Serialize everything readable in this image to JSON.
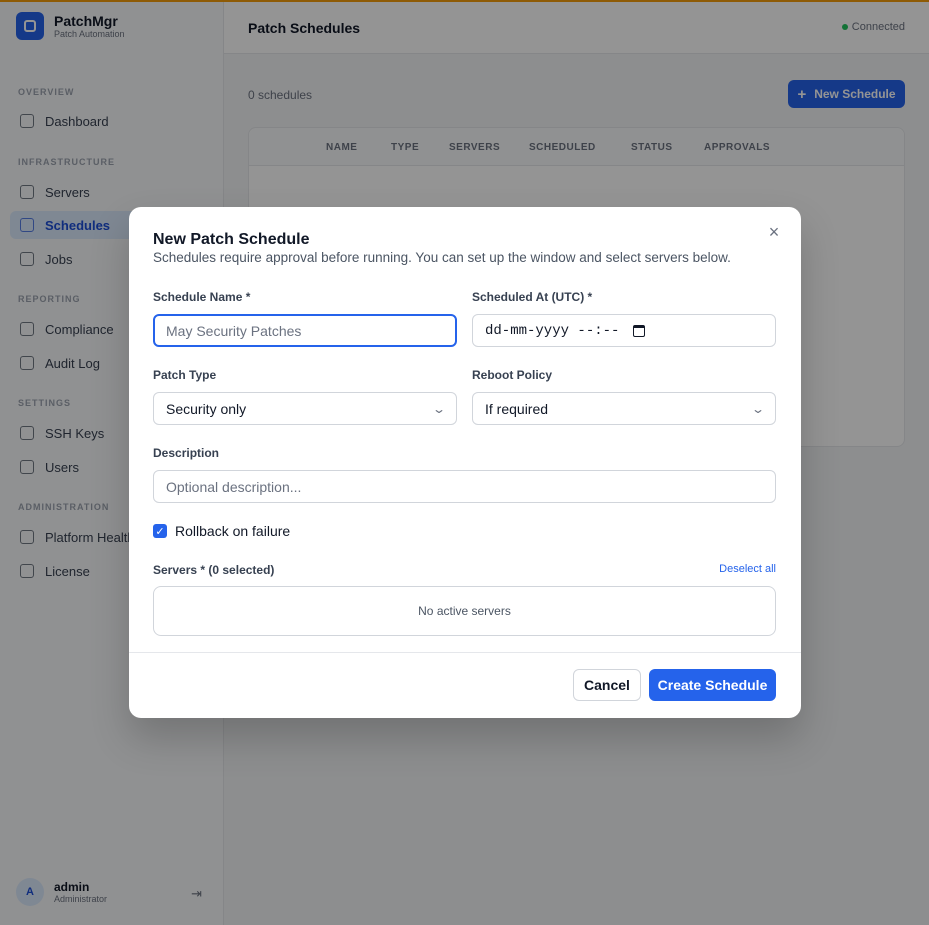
{
  "brand": {
    "name": "PatchMgr",
    "subtitle": "Patch Automation"
  },
  "sidebar": {
    "sections": [
      {
        "title": "OVERVIEW"
      },
      {
        "title": "INFRASTRUCTURE"
      },
      {
        "title": "REPORTING"
      },
      {
        "title": "SETTINGS"
      },
      {
        "title": "ADMINISTRATION"
      }
    ],
    "items": [
      {
        "label": "Dashboard",
        "icon": "dashboard-icon"
      },
      {
        "label": "Servers",
        "icon": "servers-icon"
      },
      {
        "label": "Schedules",
        "icon": "calendar-icon",
        "active": true
      },
      {
        "label": "Jobs",
        "icon": "activity-icon"
      },
      {
        "label": "Compliance",
        "icon": "document-icon"
      },
      {
        "label": "Audit Log",
        "icon": "clipboard-icon"
      },
      {
        "label": "SSH Keys",
        "icon": "key-icon"
      },
      {
        "label": "Users",
        "icon": "users-icon"
      },
      {
        "label": "Platform Health",
        "icon": "monitor-icon"
      },
      {
        "label": "License",
        "icon": "license-icon"
      }
    ],
    "user": {
      "initial": "A",
      "name": "admin",
      "role": "Administrator"
    }
  },
  "header": {
    "title": "Patch Schedules",
    "status": "Connected"
  },
  "main": {
    "count_text": "0 schedules",
    "new_button_label": "New Schedule",
    "table_columns": [
      "NAME",
      "TYPE",
      "SERVERS",
      "SCHEDULED",
      "STATUS",
      "APPROVALS"
    ]
  },
  "modal": {
    "title": "New Patch Schedule",
    "subtitle": "Schedules require approval before running. You can set up the window and select servers below.",
    "close_symbol": "×",
    "name_label": "Schedule Name *",
    "name_placeholder": "May Security Patches",
    "scheduled_label": "Scheduled At (UTC) *",
    "scheduled_value": "dd-mm-yyyy --:--",
    "patch_type_label": "Patch Type",
    "patch_type_value": "Security only",
    "reboot_label": "Reboot Policy",
    "reboot_value": "If required",
    "description_label": "Description",
    "description_placeholder": "Optional description...",
    "rollback_label": "Rollback on failure",
    "rollback_checked": true,
    "servers_label": "Servers * (0 selected)",
    "deselect_label": "Deselect all",
    "servers_empty": "No active servers",
    "cancel_label": "Cancel",
    "create_label": "Create Schedule"
  },
  "colors": {
    "accent": "#2563eb",
    "top_bar": "#f59e0b",
    "status_dot": "#22c55e"
  }
}
